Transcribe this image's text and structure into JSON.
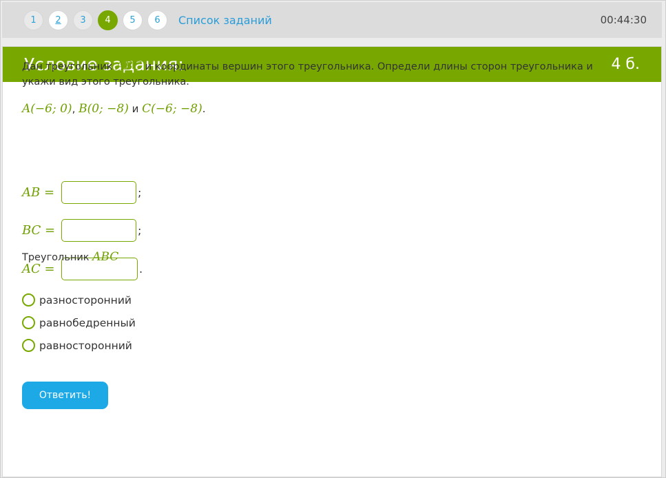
{
  "nav": {
    "tasks": [
      {
        "label": "1",
        "state": "done"
      },
      {
        "label": "2",
        "state": "visited"
      },
      {
        "label": "3",
        "state": "done"
      },
      {
        "label": "4",
        "state": "current"
      },
      {
        "label": "5",
        "state": "default"
      },
      {
        "label": "6",
        "state": "default"
      }
    ],
    "task_list_link": "Список заданий",
    "timer": "00:44:30"
  },
  "card": {
    "title": "Условие задания:",
    "points": "4 б."
  },
  "statement": {
    "part1": "Дан треугольник ",
    "triangle": "ABC",
    "part2": " и координаты вершин этого треугольника. Определи длины сторон треугольника и укажи вид этого треугольника."
  },
  "coords": {
    "a": "A(−6; 0)",
    "sep1": ", ",
    "b": "B(0; −8)",
    "conj": " и ",
    "c": "C(−6; −8)",
    "end": "."
  },
  "equations": [
    {
      "label": "AB =",
      "value": "",
      "punct": ";"
    },
    {
      "label": "BC =",
      "value": "",
      "punct": ";"
    },
    {
      "label": "AC =",
      "value": "",
      "punct": "."
    }
  ],
  "triangle_question": {
    "text": "Треугольник ",
    "name": "ABC"
  },
  "options": [
    {
      "label": "разносторонний",
      "selected": false
    },
    {
      "label": "равнобедренный",
      "selected": false
    },
    {
      "label": "равносторонний",
      "selected": false
    }
  ],
  "submit_label": "Ответить!",
  "colors": {
    "accent_green": "#78a800",
    "link_blue": "#2a9dd8",
    "button_blue": "#1ca9e6"
  }
}
